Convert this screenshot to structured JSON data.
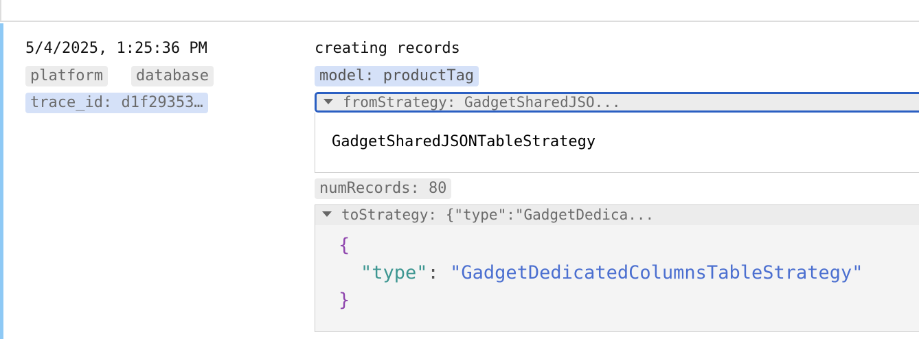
{
  "entry": {
    "timestamp": "5/4/2025, 1:25:36 PM",
    "tags": [
      "platform",
      "database"
    ],
    "trace_id": "trace_id: d1f29353…",
    "message": "creating records",
    "fields": {
      "model": "model: productTag",
      "fromStrategy_header": "fromStrategy: GadgetSharedJSO...",
      "fromStrategy_value": "GadgetSharedJSONTableStrategy",
      "numRecords": "numRecords: 80",
      "toStrategy_header": "toStrategy: {\"type\":\"GadgetDedica...",
      "toStrategy_json": {
        "open": "{",
        "key": "\"type\"",
        "colon": ": ",
        "value": "\"GadgetDedicatedColumnsTableStrategy\"",
        "close": "}"
      }
    }
  }
}
